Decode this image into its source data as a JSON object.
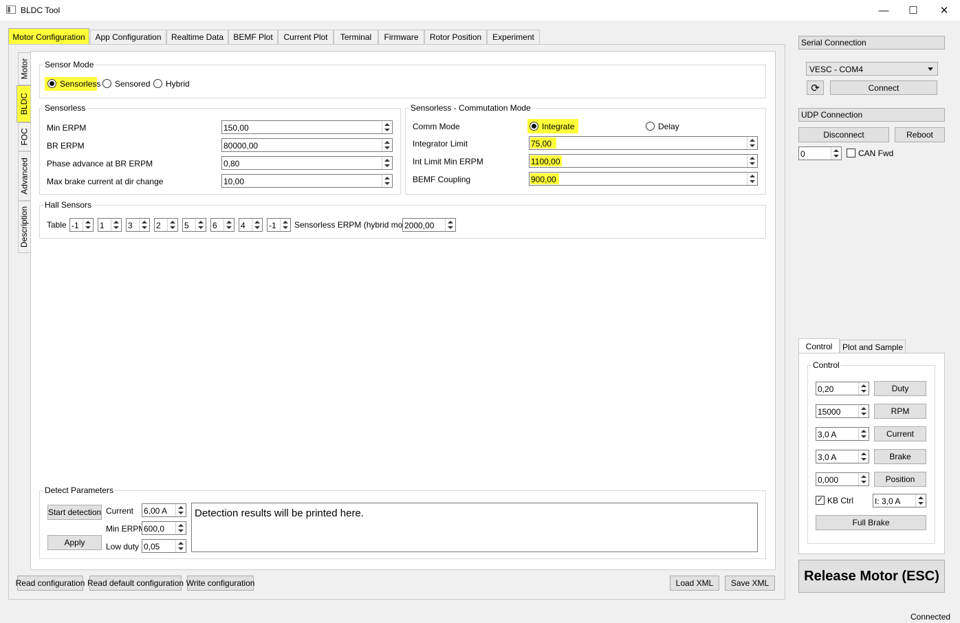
{
  "window": {
    "title": "BLDC Tool",
    "minimize_icon": "minimize-icon",
    "maximize_icon": "maximize-icon",
    "close_icon": "close-icon"
  },
  "tabs": [
    "Motor Configuration",
    "App Configuration",
    "Realtime Data",
    "BEMF Plot",
    "Current Plot",
    "Terminal",
    "Firmware",
    "Rotor Position",
    "Experiment"
  ],
  "side_tabs": [
    "Motor",
    "BLDC",
    "FOC",
    "Advanced",
    "Description"
  ],
  "sensor_mode": {
    "title": "Sensor Mode",
    "options": [
      "Sensorless",
      "Sensored",
      "Hybrid"
    ],
    "selected": "Sensorless"
  },
  "sensorless": {
    "title": "Sensorless",
    "fields": [
      {
        "label": "Min ERPM",
        "value": "150,00"
      },
      {
        "label": "BR ERPM",
        "value": "80000,00"
      },
      {
        "label": "Phase advance at BR ERPM",
        "value": "0,80"
      },
      {
        "label": "Max brake current at dir change",
        "value": "10,00"
      }
    ]
  },
  "commutation": {
    "title": "Sensorless - Commutation Mode",
    "comm_mode_label": "Comm Mode",
    "options": [
      "Integrate",
      "Delay"
    ],
    "selected": "Integrate",
    "fields": [
      {
        "label": "Integrator Limit",
        "value": "75,00"
      },
      {
        "label": "Int Limit Min ERPM",
        "value": "1100,00"
      },
      {
        "label": "BEMF Coupling",
        "value": "900,00"
      }
    ]
  },
  "hall": {
    "title": "Hall Sensors",
    "table_label": "Table",
    "table": [
      "-1",
      "1",
      "3",
      "2",
      "5",
      "6",
      "4",
      "-1"
    ],
    "hybrid_label": "Sensorless ERPM (hybrid mode)",
    "hybrid_value": "2000,00"
  },
  "detect": {
    "title": "Detect Parameters",
    "start_button": "Start detection",
    "apply_button": "Apply",
    "current_label": "Current",
    "current_value": "6,00 A",
    "min_erpm_label": "Min ERPM",
    "min_erpm_value": "600,0",
    "low_duty_label": "Low duty",
    "low_duty_value": "0,05",
    "results_text": "Detection results will be printed here."
  },
  "bottom_buttons": {
    "read_config": "Read configuration",
    "read_default": "Read default configuration",
    "write_config": "Write configuration",
    "load_xml": "Load XML",
    "save_xml": "Save XML"
  },
  "serial": {
    "header": "Serial Connection",
    "port": "VESC - COM4",
    "connect_button": "Connect",
    "refresh_icon": "refresh-icon"
  },
  "udp": {
    "header": "UDP Connection",
    "disconnect_button": "Disconnect",
    "reboot_button": "Reboot",
    "can_id": "0",
    "can_fwd_label": "CAN Fwd",
    "can_fwd_checked": false
  },
  "control_tabs": [
    "Control",
    "Plot and Sample"
  ],
  "control": {
    "title": "Control",
    "rows": [
      {
        "value": "0,20",
        "button": "Duty"
      },
      {
        "value": "15000",
        "button": "RPM"
      },
      {
        "value": "3,0 A",
        "button": "Current"
      },
      {
        "value": "3,0 A",
        "button": "Brake"
      },
      {
        "value": "0,000",
        "button": "Position"
      }
    ],
    "kb_ctrl_label": "KB Ctrl",
    "kb_ctrl_checked": true,
    "kb_current": "I: 3,0 A",
    "full_brake_button": "Full Brake"
  },
  "release_button": "Release Motor (ESC)",
  "status": "Connected",
  "colors": {
    "highlight": "#ffff3a",
    "window_bg": "#f0f0f0",
    "panel_bg": "#ffffff"
  }
}
